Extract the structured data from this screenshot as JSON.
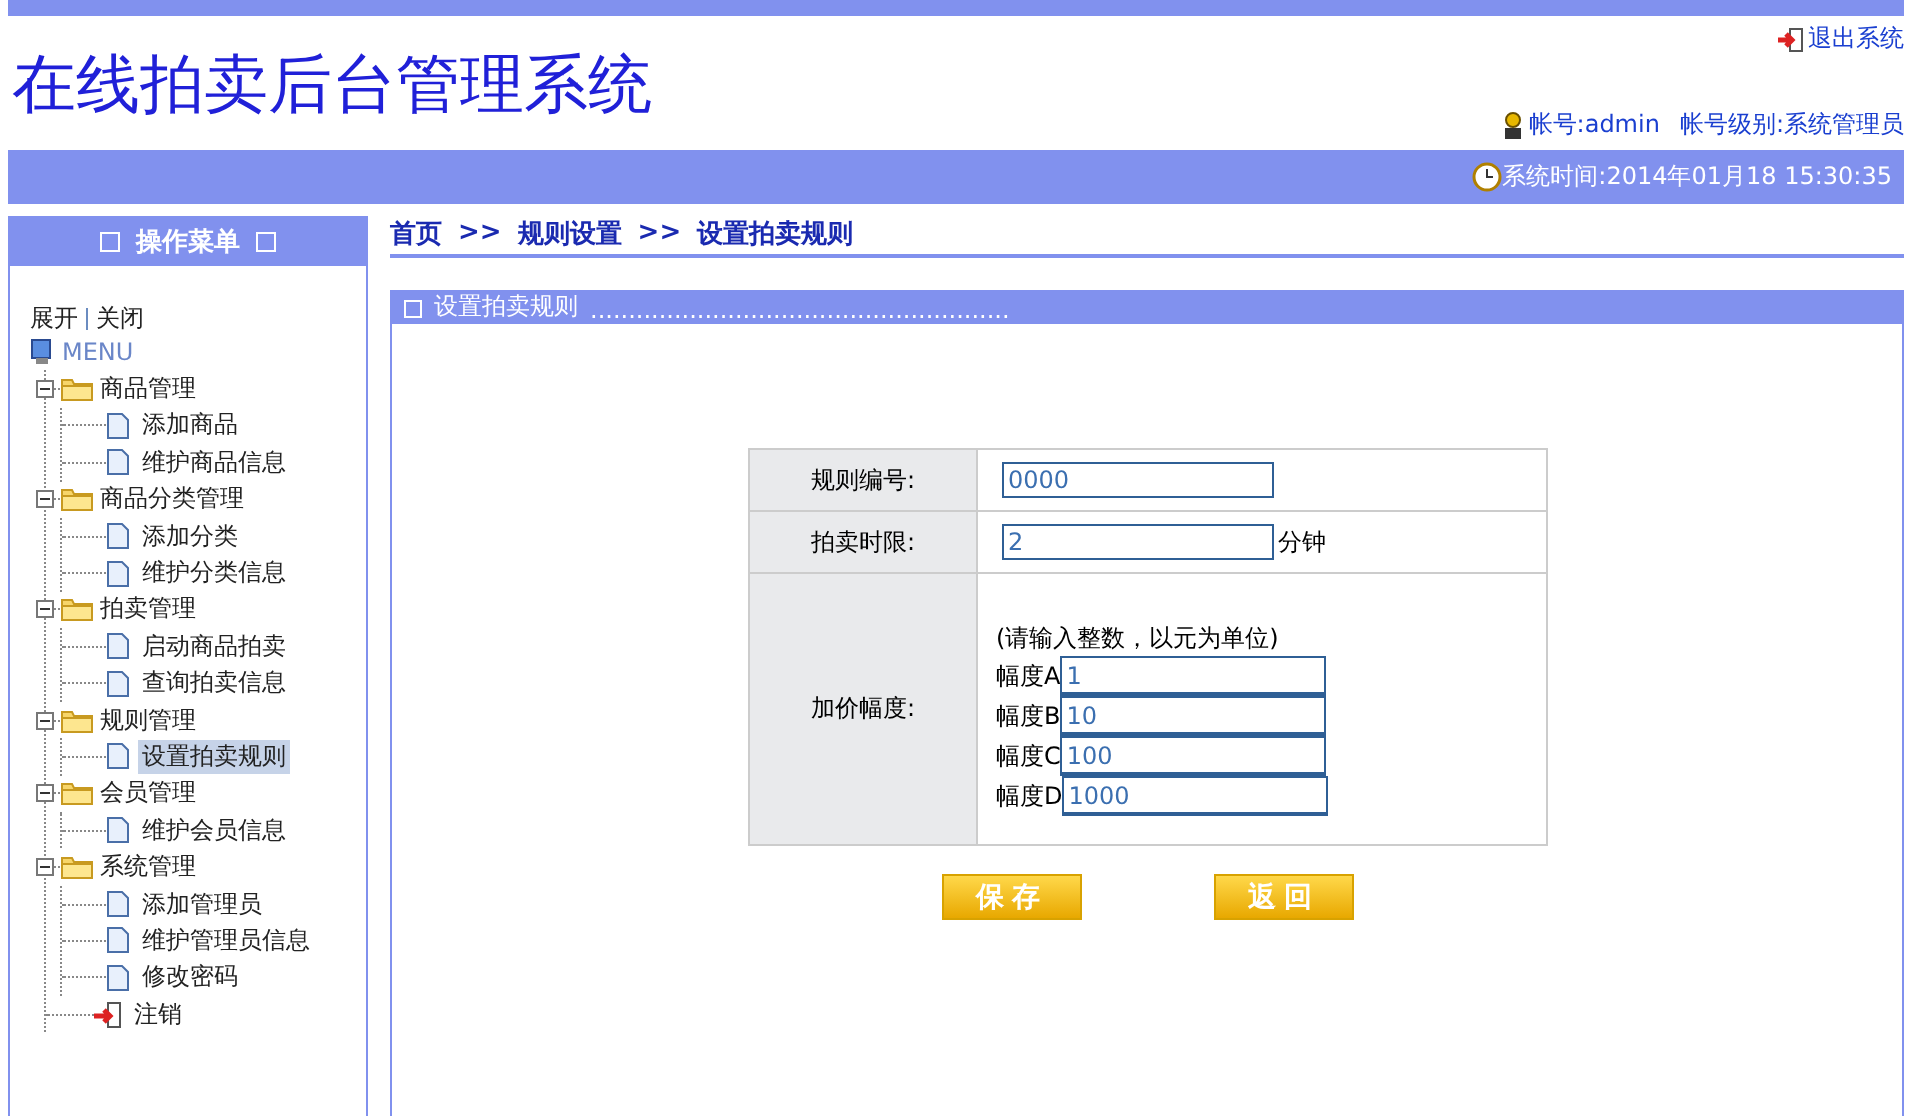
{
  "header": {
    "title": "在线拍卖后台管理系统",
    "logout": "退出系统",
    "account": "帐号:admin",
    "level": "帐号级别:系统管理员",
    "time": "系统时间:2014年01月18 15:30:35"
  },
  "sidebar": {
    "title": "操作菜单",
    "toggle": [
      "展开",
      "关闭"
    ],
    "root": "MENU",
    "groups": [
      {
        "label": "商品管理",
        "expanded": true,
        "children": [
          {
            "label": "添加商品",
            "selected": false
          },
          {
            "label": "维护商品信息",
            "selected": false
          }
        ]
      },
      {
        "label": "商品分类管理",
        "expanded": true,
        "children": [
          {
            "label": "添加分类",
            "selected": false
          },
          {
            "label": "维护分类信息",
            "selected": false
          }
        ]
      },
      {
        "label": "拍卖管理",
        "expanded": true,
        "children": [
          {
            "label": "启动商品拍卖",
            "selected": false
          },
          {
            "label": "查询拍卖信息",
            "selected": false
          }
        ]
      },
      {
        "label": "规则管理",
        "expanded": true,
        "children": [
          {
            "label": "设置拍卖规则",
            "selected": true
          }
        ]
      },
      {
        "label": "会员管理",
        "expanded": true,
        "children": [
          {
            "label": "维护会员信息",
            "selected": false
          }
        ]
      },
      {
        "label": "系统管理",
        "expanded": true,
        "children": [
          {
            "label": "添加管理员",
            "selected": false
          },
          {
            "label": "维护管理员信息",
            "selected": false
          },
          {
            "label": "修改密码",
            "selected": false
          }
        ]
      }
    ],
    "signout": "注销"
  },
  "breadcrumb": [
    "首页",
    ">>",
    "规则设置",
    ">>",
    "设置拍卖规则"
  ],
  "panel": {
    "title": "设置拍卖规则",
    "dots": "......................................................."
  },
  "form": {
    "rule_no": {
      "label": "规则编号:",
      "value": "0000"
    },
    "time_limit": {
      "label": "拍卖时限:",
      "value": "2",
      "unit": "分钟"
    },
    "increment": {
      "label": "加价幅度:",
      "hint": "(请输入整数，以元为单位)",
      "levels": [
        {
          "label": "幅度A",
          "value": "1"
        },
        {
          "label": "幅度B",
          "value": "10"
        },
        {
          "label": "幅度C",
          "value": "100"
        },
        {
          "label": "幅度D",
          "value": "1000"
        }
      ]
    }
  },
  "buttons": [
    "保存",
    "返回"
  ]
}
